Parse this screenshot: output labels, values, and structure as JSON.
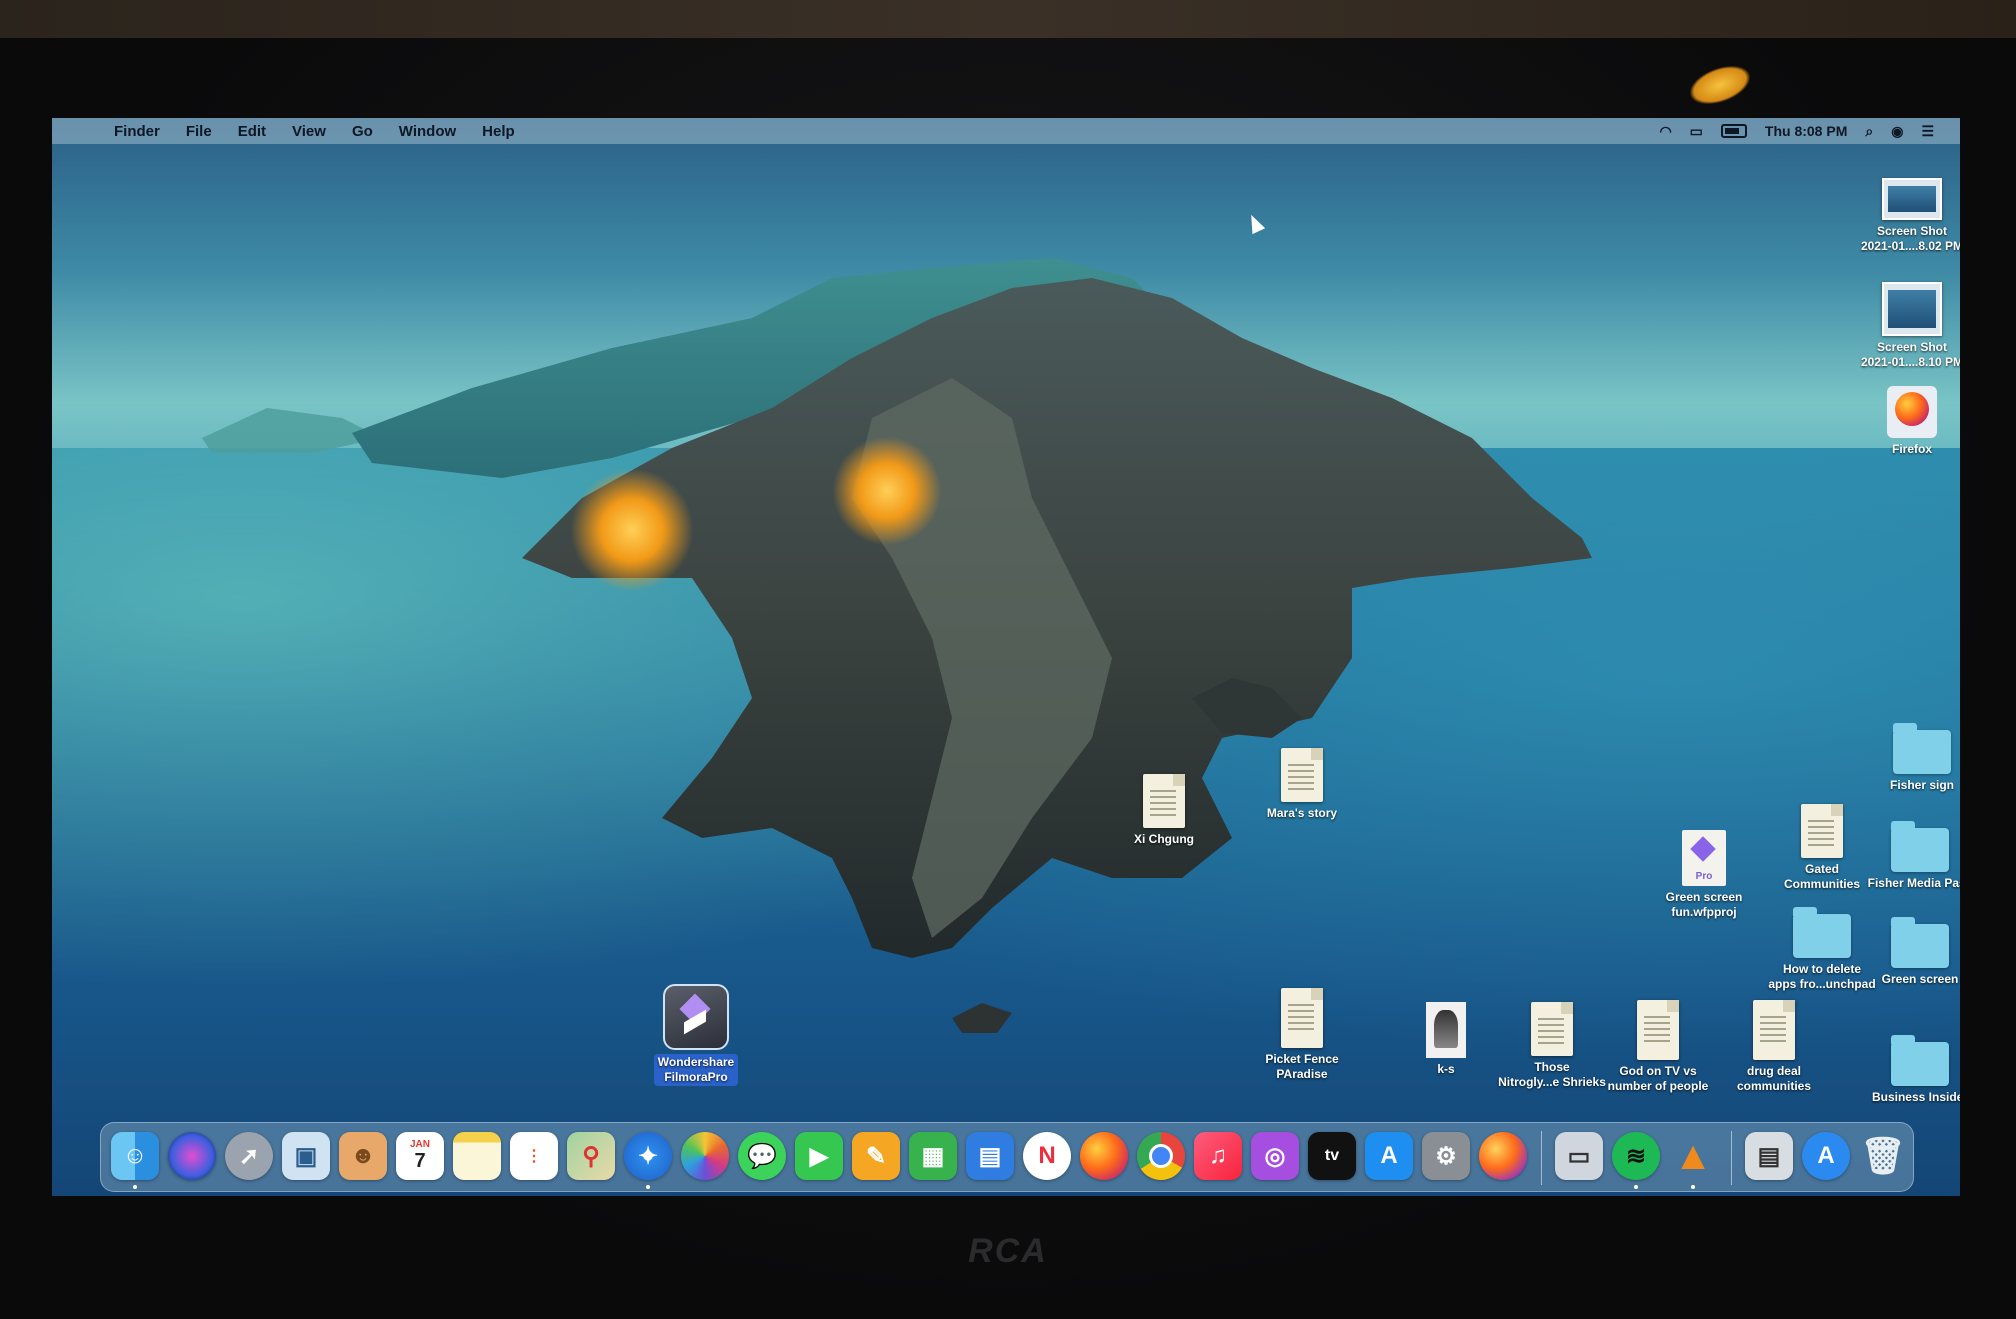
{
  "menubar": {
    "apple": "",
    "items": [
      "Finder",
      "File",
      "Edit",
      "View",
      "Go",
      "Window",
      "Help"
    ],
    "clock": "Thu 8:08 PM",
    "status_icons": [
      "wifi-icon",
      "airplay-icon",
      "battery-icon",
      "search-icon",
      "user-icon",
      "control-center-icon"
    ]
  },
  "desktop": {
    "screenshot1": "Screen Shot\n2021-01....8.02 PM",
    "screenshot2": "Screen Shot\n2021-01....8.10 PM",
    "firefox": "Firefox",
    "fisher_sign": "Fisher sign",
    "fisher_media_pass": "Fisher Media Pass",
    "green_screen": "Green screen",
    "business_insider": "Business Insider",
    "gated_communities": "Gated\nCommunities",
    "how_to_delete": "How to delete\napps fro...unchpad",
    "green_screen_proj": "Green screen\nfun.wfpproj",
    "xi_chgung": "Xi Chgung",
    "maras_story": "Mara's story",
    "picket_fence": "Picket Fence\nPAradise",
    "k_s": "k-s",
    "those_nitrogly": "Those\nNitrogly...e Shrieks",
    "god_on_tv": "God on TV vs\nnumber of people",
    "drug_deal": "drug deal\ncommunities",
    "filmora": "Wondershare\nFilmoraPro",
    "pro_badge": "Pro"
  },
  "dock": {
    "apps": [
      "Finder",
      "Siri",
      "Launchpad",
      "Preview",
      "Contacts",
      "Calendar",
      "Notes",
      "Reminders",
      "Maps",
      "Safari",
      "Photos",
      "Messages",
      "FaceTime",
      "Pages",
      "Numbers",
      "Keynote",
      "News",
      "Firefox",
      "Chrome",
      "Music",
      "Podcasts",
      "TV",
      "App Store",
      "System Preferences",
      "Firefox Developer",
      "Image Capture",
      "Spotify",
      "VLC",
      "Downloads",
      "Applications",
      "Trash"
    ],
    "calendar_month": "JAN",
    "calendar_day": "7",
    "tv_label": "tv"
  },
  "tv": {
    "brand": "RCA"
  }
}
